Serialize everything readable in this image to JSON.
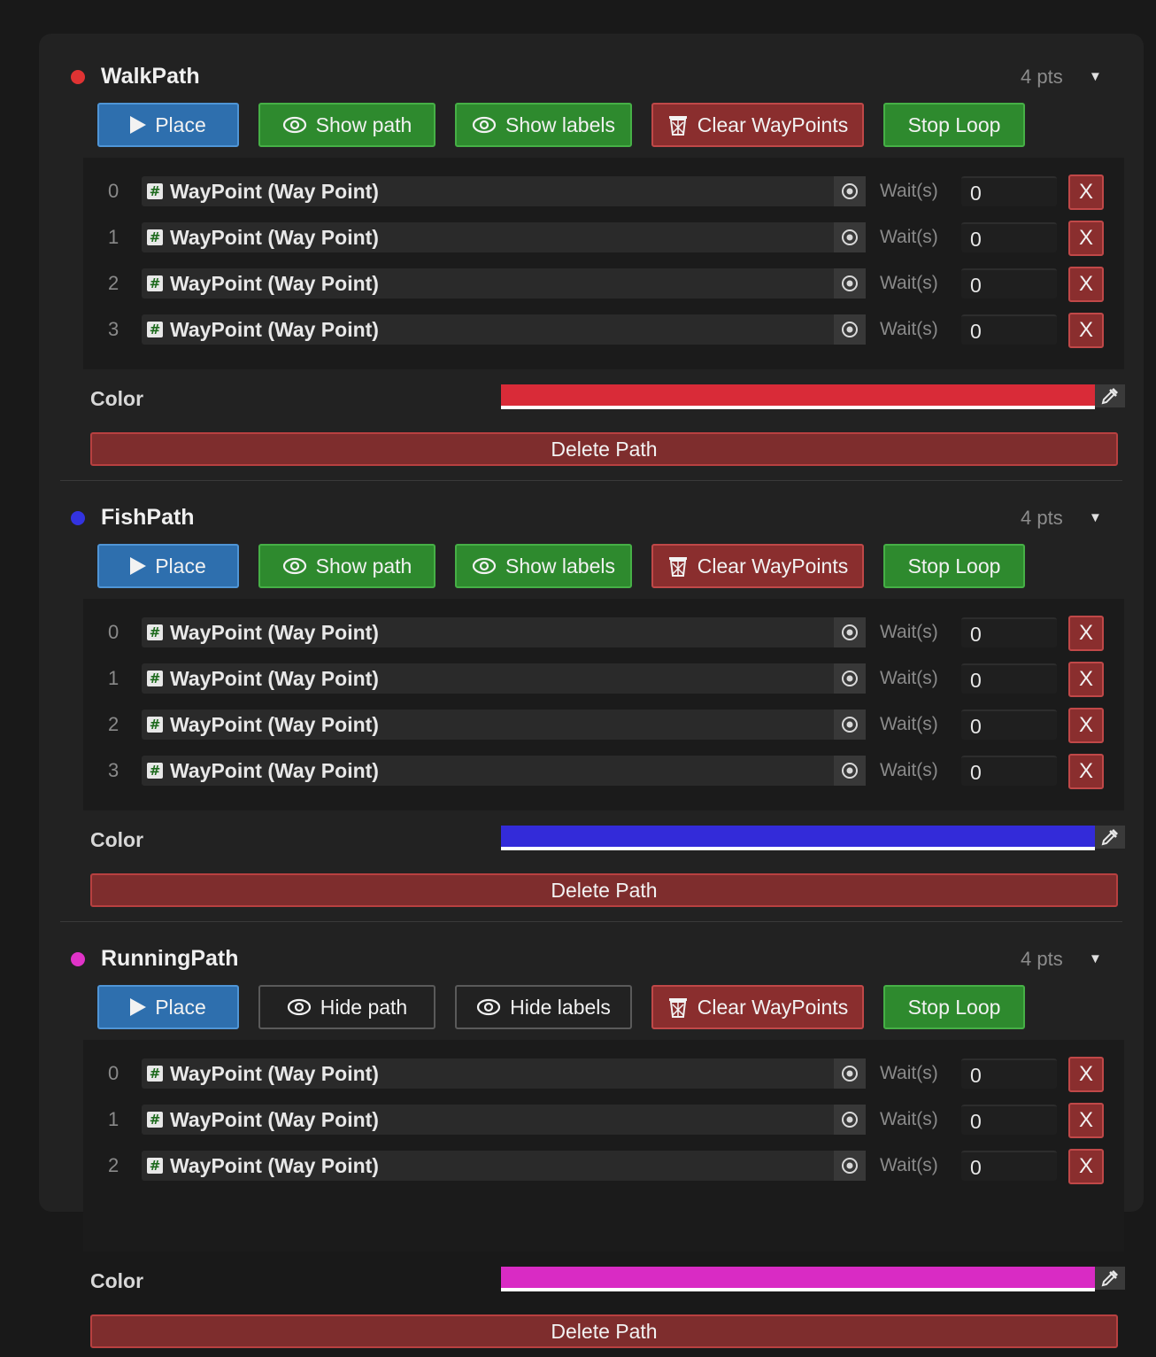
{
  "paths": [
    {
      "name": "WalkPath",
      "count_label": "4 pts",
      "caret": "▼",
      "dot_color": "#e03333",
      "color_value": "#d92b38",
      "buttons": {
        "place": "Place",
        "path_toggle": "Show path",
        "labels_toggle": "Show labels",
        "clear": "Clear WayPoints",
        "loop": "Stop Loop",
        "toggles_active": true
      },
      "waypoints": [
        {
          "index": "0",
          "name": "WayPoint (Way Point)",
          "wait_label": "Wait(s)",
          "wait": "0",
          "remove": "X"
        },
        {
          "index": "1",
          "name": "WayPoint (Way Point)",
          "wait_label": "Wait(s)",
          "wait": "0",
          "remove": "X"
        },
        {
          "index": "2",
          "name": "WayPoint (Way Point)",
          "wait_label": "Wait(s)",
          "wait": "0",
          "remove": "X"
        },
        {
          "index": "3",
          "name": "WayPoint (Way Point)",
          "wait_label": "Wait(s)",
          "wait": "0",
          "remove": "X"
        }
      ],
      "color_label": "Color",
      "delete_label": "Delete Path"
    },
    {
      "name": "FishPath",
      "count_label": "4 pts",
      "caret": "▼",
      "dot_color": "#3333e0",
      "color_value": "#332bd9",
      "buttons": {
        "place": "Place",
        "path_toggle": "Show path",
        "labels_toggle": "Show labels",
        "clear": "Clear WayPoints",
        "loop": "Stop Loop",
        "toggles_active": true
      },
      "waypoints": [
        {
          "index": "0",
          "name": "WayPoint (Way Point)",
          "wait_label": "Wait(s)",
          "wait": "0",
          "remove": "X"
        },
        {
          "index": "1",
          "name": "WayPoint (Way Point)",
          "wait_label": "Wait(s)",
          "wait": "0",
          "remove": "X"
        },
        {
          "index": "2",
          "name": "WayPoint (Way Point)",
          "wait_label": "Wait(s)",
          "wait": "0",
          "remove": "X"
        },
        {
          "index": "3",
          "name": "WayPoint (Way Point)",
          "wait_label": "Wait(s)",
          "wait": "0",
          "remove": "X"
        }
      ],
      "color_label": "Color",
      "delete_label": "Delete Path"
    },
    {
      "name": "RunningPath",
      "count_label": "4 pts",
      "caret": "▼",
      "dot_color": "#e033c8",
      "color_value": "#d92bc4",
      "buttons": {
        "place": "Place",
        "path_toggle": "Hide path",
        "labels_toggle": "Hide labels",
        "clear": "Clear WayPoints",
        "loop": "Stop Loop",
        "toggles_active": false
      },
      "waypoints": [
        {
          "index": "0",
          "name": "WayPoint (Way Point)",
          "wait_label": "Wait(s)",
          "wait": "0",
          "remove": "X"
        },
        {
          "index": "1",
          "name": "WayPoint (Way Point)",
          "wait_label": "Wait(s)",
          "wait": "0",
          "remove": "X"
        },
        {
          "index": "2",
          "name": "WayPoint (Way Point)",
          "wait_label": "Wait(s)",
          "wait": "0",
          "remove": "X"
        }
      ],
      "color_label": "Color",
      "delete_label": "Delete Path"
    }
  ]
}
